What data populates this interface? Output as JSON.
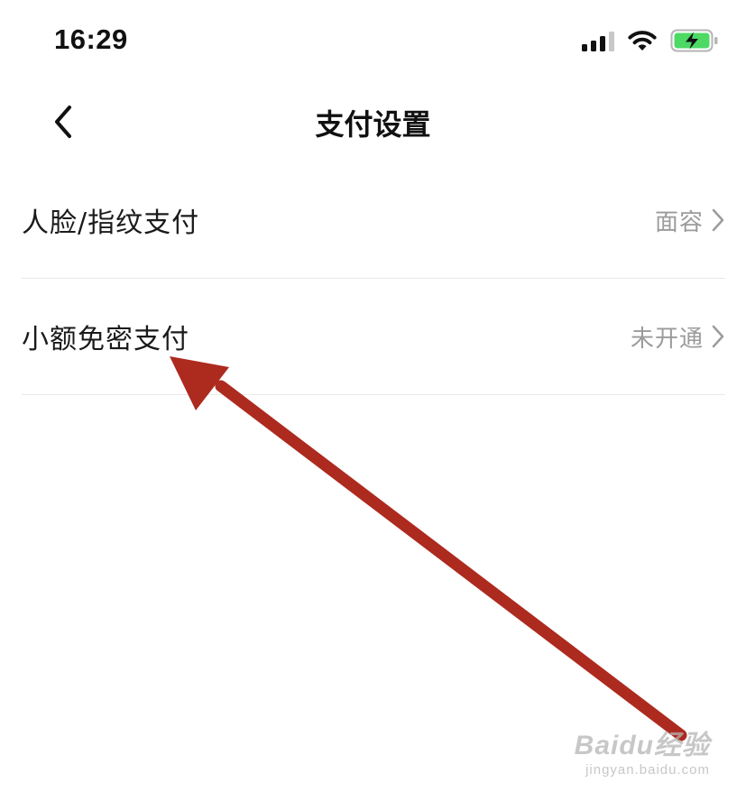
{
  "status_bar": {
    "time": "16:29",
    "signal_icon": "cellular-signal-icon",
    "wifi_icon": "wifi-icon",
    "battery_icon": "battery-charging-icon",
    "battery_color": "#4cd964"
  },
  "nav": {
    "back_icon": "chevron-left-icon",
    "title": "支付设置"
  },
  "settings": [
    {
      "label": "人脸/指纹支付",
      "value": "面容",
      "icon": "chevron-right-icon"
    },
    {
      "label": "小额免密支付",
      "value": "未开通",
      "icon": "chevron-right-icon"
    }
  ],
  "annotation": {
    "arrow_color": "#ad2a1f",
    "points_to": "小额免密支付"
  },
  "watermark": {
    "brand": "Baidu经验",
    "url": "jingyan.baidu.com"
  }
}
